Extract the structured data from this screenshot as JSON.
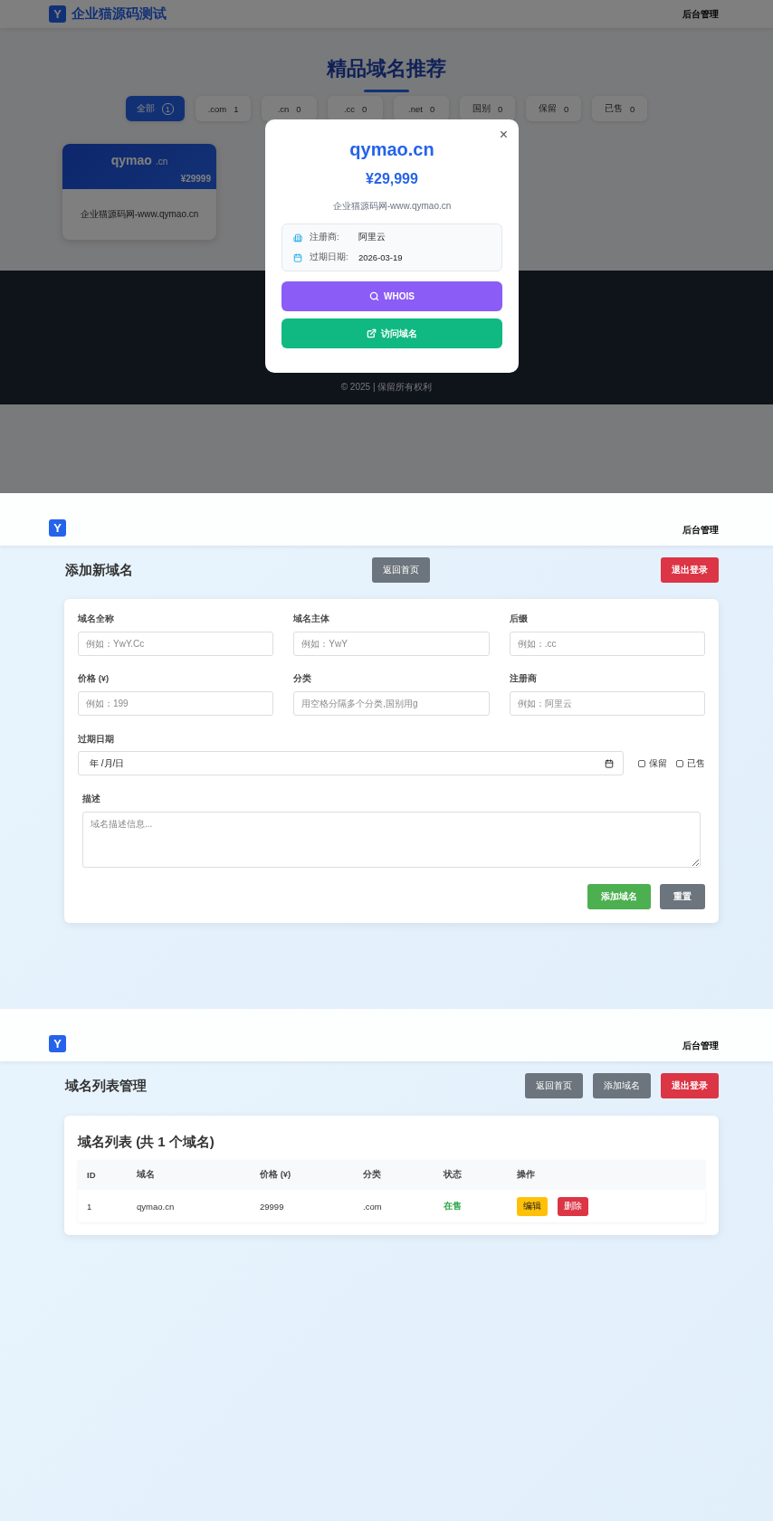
{
  "home": {
    "brand": {
      "logo": "Y",
      "name": "企业猫源码测试"
    },
    "nav_link": "后台管理",
    "heading": "精品域名推荐",
    "filters": [
      {
        "label": "全部",
        "count": "1",
        "selected": true
      },
      {
        "label": ".com",
        "count": "1",
        "selected": false
      },
      {
        "label": ".cn",
        "count": "0",
        "selected": false
      },
      {
        "label": ".cc",
        "count": "0",
        "selected": false
      },
      {
        "label": ".net",
        "count": "0",
        "selected": false
      },
      {
        "label": "国别",
        "count": "0",
        "selected": false
      },
      {
        "label": "保留",
        "count": "0",
        "selected": false
      },
      {
        "label": "已售",
        "count": "0",
        "selected": false
      }
    ],
    "cards": [
      {
        "name": "qymao",
        "suffix": ".cn",
        "price": "¥29999",
        "description": "企业猫源码网-www.qymao.cn"
      }
    ],
    "footer": "© 2025 | 保留所有权利",
    "modal": {
      "close": "×",
      "domain": "qymao.cn",
      "price": "¥29,999",
      "description": "企业猫源码网-www.qymao.cn",
      "details": [
        {
          "kind": "registrar",
          "label": "注册商:",
          "value": "阿里云"
        },
        {
          "kind": "expiry",
          "label": "过期日期:",
          "value": "2026-03-19"
        }
      ],
      "buttons": [
        {
          "kind": "whois",
          "label": "WHOIS"
        },
        {
          "kind": "visit",
          "label": "访问域名"
        }
      ]
    }
  },
  "add_page": {
    "logo": "Y",
    "nav_link": "后台管理",
    "title": "添加新域名",
    "home_button": "返回首页",
    "logout_button": "退出登录",
    "fields": [
      {
        "label": "域名全称",
        "placeholder": "例如：YwY.Cc"
      },
      {
        "label": "域名主体",
        "placeholder": "例如：YwY"
      },
      {
        "label": "后缀",
        "placeholder": "例如：.cc"
      },
      {
        "label": "价格 (¥)",
        "placeholder": "例如：199"
      },
      {
        "label": "分类",
        "placeholder": "用空格分隔多个分类,国别用g"
      },
      {
        "label": "注册商",
        "placeholder": "例如：阿里云"
      }
    ],
    "date": {
      "label": "过期日期",
      "value": "年 /月/日"
    },
    "checkboxes": [
      {
        "label": "保留",
        "checked": false
      },
      {
        "label": "已售",
        "checked": false
      }
    ],
    "description": {
      "label": "描述",
      "placeholder": "域名描述信息..."
    },
    "buttons": [
      {
        "kind": "primary",
        "label": "添加域名"
      },
      {
        "kind": "secondary",
        "label": "重置"
      }
    ]
  },
  "list_page": {
    "logo": "Y",
    "nav_link": "后台管理",
    "title": "域名列表管理",
    "actions": [
      {
        "kind": "secondary",
        "label": "返回首页"
      },
      {
        "kind": "secondary",
        "label": "添加域名"
      },
      {
        "kind": "danger",
        "label": "退出登录"
      }
    ],
    "card_title": "域名列表 (共 1 个域名)",
    "table": {
      "columns": [
        "ID",
        "域名",
        "价格 (¥)",
        "分类",
        "状态",
        "操作"
      ],
      "rows": [
        {
          "id": "1",
          "domain": "qymao.cn",
          "price": "29999",
          "category": ".com",
          "status": "在售",
          "actions": [
            {
              "kind": "edit",
              "label": "编辑"
            },
            {
              "kind": "delete",
              "label": "删除"
            }
          ]
        }
      ]
    }
  }
}
